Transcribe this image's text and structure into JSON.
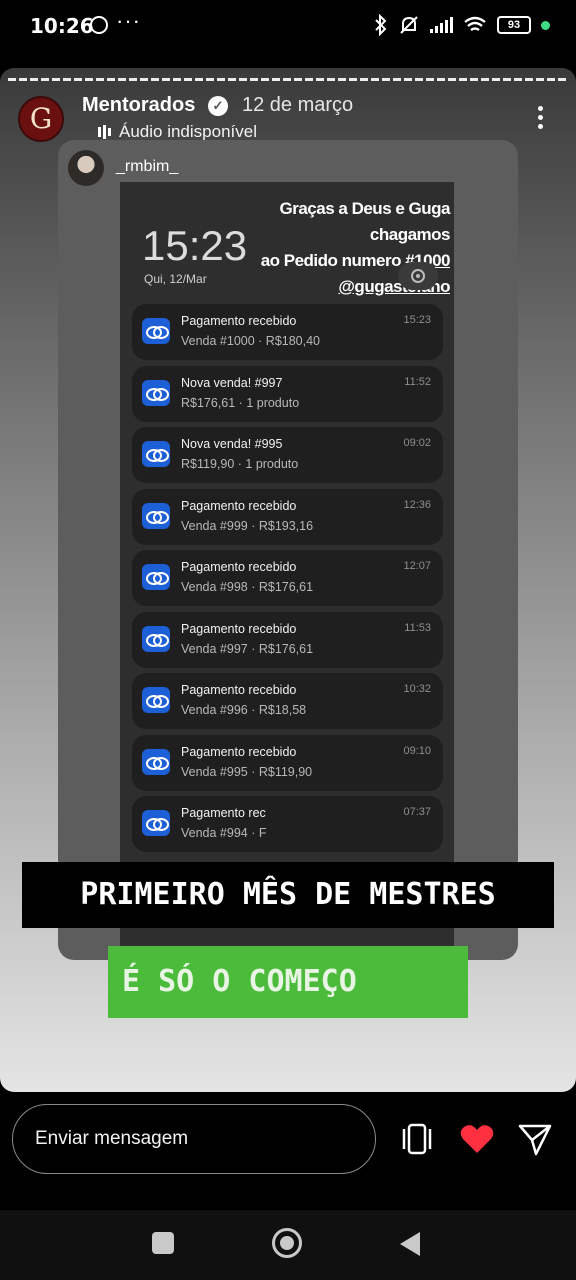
{
  "status_bar": {
    "time": "10:26",
    "overflow": "···",
    "battery": "93",
    "icons": [
      "whatsapp-icon",
      "bluetooth-icon",
      "silent-icon",
      "signal-icon",
      "wifi-icon",
      "battery-icon"
    ]
  },
  "story": {
    "author": "Mentorados",
    "avatar_letter": "G",
    "date": "12 de março",
    "audio_status": "Áudio indisponível",
    "repost": {
      "username": "_rmbim_",
      "lock_time": "15:23",
      "lock_date": "Qui, 12/Mar",
      "headline_line1": "Graças a Deus e Guga chagamos",
      "headline_line2_prefix": "ao Pedido numero #",
      "headline_line2_number": "1000",
      "headline_line3": "@gugastefano",
      "notifications": [
        {
          "title": "Pagamento recebido",
          "subtitle": "Venda #1000 · R$180,40",
          "time": "15:23"
        },
        {
          "title": "Nova venda! #997",
          "subtitle": "R$176,61 · 1 produto",
          "time": "11:52"
        },
        {
          "title": "Nova venda! #995",
          "subtitle": "R$119,90 · 1 produto",
          "time": "09:02"
        },
        {
          "title": "Pagamento recebido",
          "subtitle": "Venda #999 · R$193,16",
          "time": "12:36"
        },
        {
          "title": "Pagamento recebido",
          "subtitle": "Venda #998 · R$176,61",
          "time": "12:07"
        },
        {
          "title": "Pagamento recebido",
          "subtitle": "Venda #997 · R$176,61",
          "time": "11:53"
        },
        {
          "title": "Pagamento recebido",
          "subtitle": "Venda #996 · R$18,58",
          "time": "10:32"
        },
        {
          "title": "Pagamento recebido",
          "subtitle": "Venda #995 · R$119,90",
          "time": "09:10"
        },
        {
          "title": "Pagamento rec",
          "subtitle": "Venda #994 · F",
          "time": "07:37"
        }
      ],
      "close_symbol": "×"
    },
    "banner_top": "PRIMEIRO MÊS DE MESTRES",
    "banner_bottom": "É SÓ O COMEÇO",
    "colors": {
      "banner_top_bg": "#000000",
      "banner_bottom_bg": "#4cbb3c",
      "notif_icon": "#1c5fd6",
      "like": "#ff3040"
    }
  },
  "reply_bar": {
    "placeholder": "Enviar mensagem"
  }
}
